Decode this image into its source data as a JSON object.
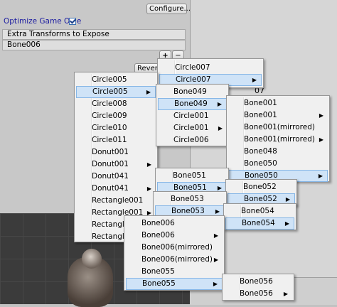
{
  "inspector": {
    "configure_label": "Configure...",
    "optimize_label": "Optimize Game Obje",
    "optimize_checked": true,
    "extra_transforms_label": "Extra Transforms to Expose",
    "extra_transforms_item": "Bone006",
    "plus_label": "+",
    "minus_label": "−",
    "revert_label": "Revert"
  },
  "behind_label": "07",
  "menus": {
    "m1": [
      "Circle007",
      "Circle007"
    ],
    "m2": [
      "Circle005",
      "Circle005",
      "Circle008",
      "Circle009",
      "Circle010",
      "Circle011",
      "Donut001",
      "Donut001",
      "Donut041",
      "Donut041",
      "Rectangle001",
      "Rectangle001",
      "Rectangle0",
      "Rectangle0"
    ],
    "m3": [
      "Bone049",
      "Bone049",
      "Circle001",
      "Circle001",
      "Circle006"
    ],
    "m4": [
      "Bone001",
      "Bone001",
      "Bone001(mirrored)",
      "Bone001(mirrored)",
      "Bone048",
      "Bone050",
      "Bone050"
    ],
    "m5": [
      "Bone051",
      "Bone051"
    ],
    "m6": [
      "Bone052",
      "Bone052"
    ],
    "m7": [
      "Bone053",
      "Bone053"
    ],
    "m8": [
      "Bone054",
      "Bone054"
    ],
    "m9": [
      "Bone006",
      "Bone006",
      "Bone006(mirrored)",
      "Bone006(mirrored)",
      "Bone055",
      "Bone055"
    ],
    "m10": [
      "Bone056",
      "Bone056"
    ]
  },
  "colors": {
    "highlight": "#cfe3f7",
    "highlight_border": "#86b6e6",
    "menu_bg": "#f0f0f0"
  }
}
